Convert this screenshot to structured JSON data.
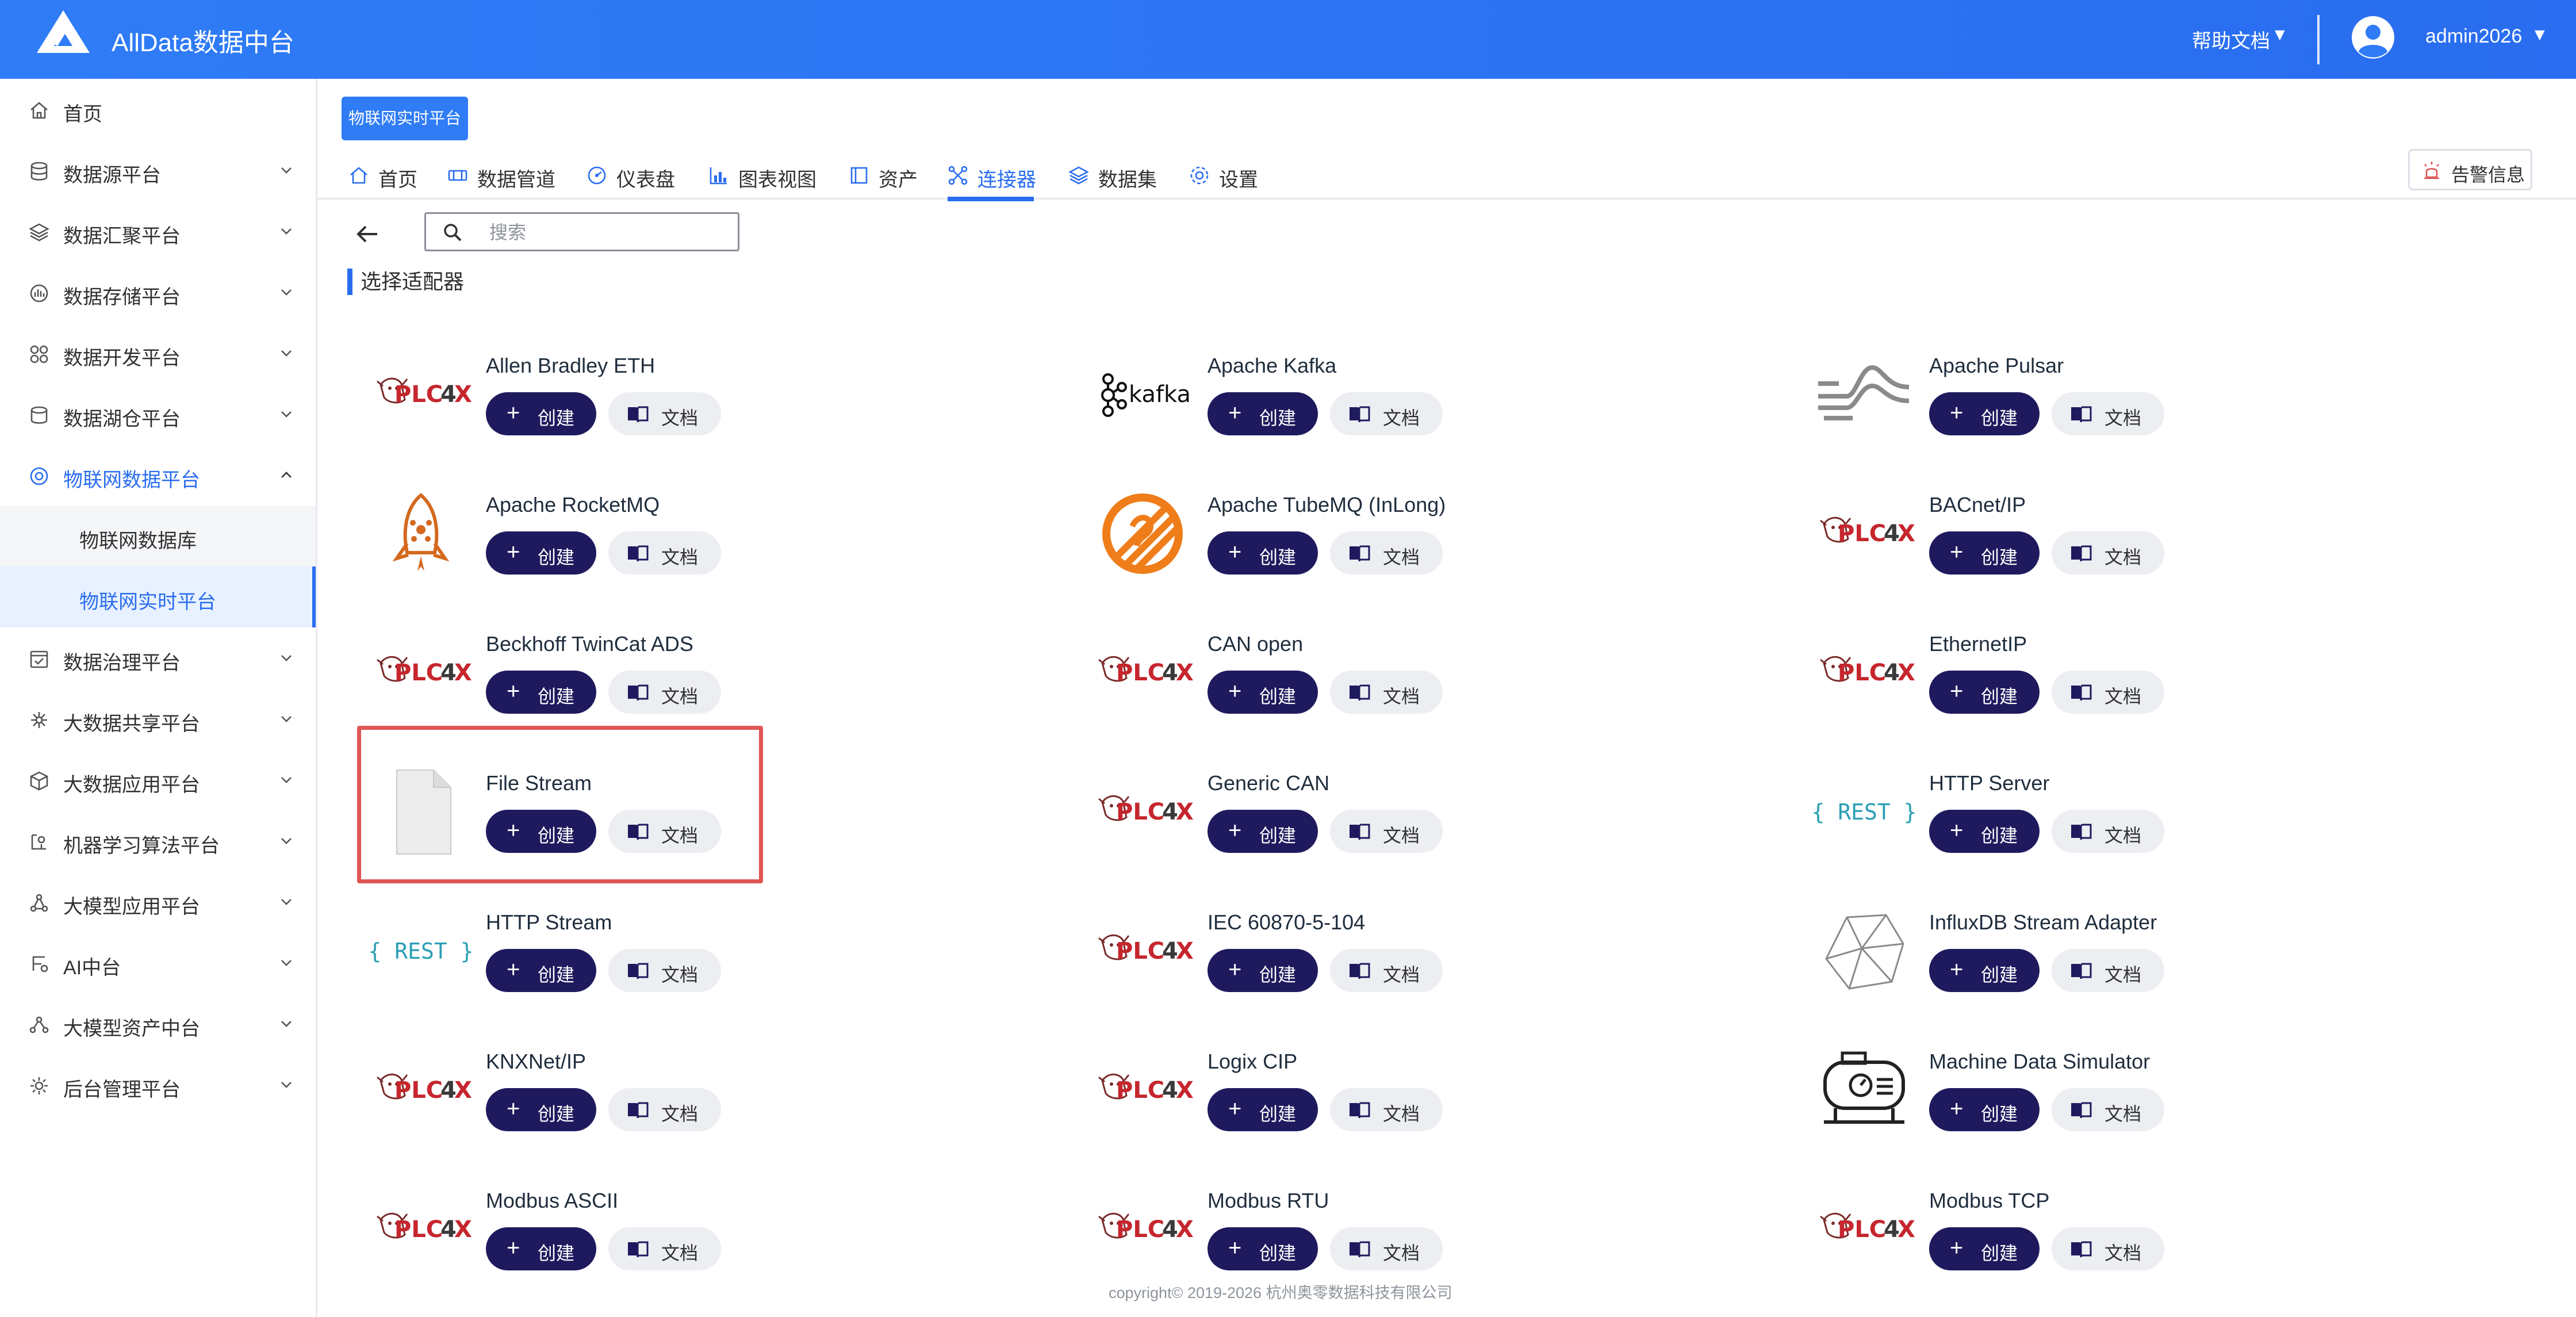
{
  "header": {
    "app_title": "AllData数据中台",
    "help_label": "帮助文档",
    "help_arrow": "▼",
    "username": "admin2026",
    "user_arrow": "▼"
  },
  "sidebar": {
    "items": [
      {
        "label": "首页",
        "icon": "home-icon"
      },
      {
        "label": "数据源平台",
        "icon": "database-icon"
      },
      {
        "label": "数据汇聚平台",
        "icon": "layers-icon"
      },
      {
        "label": "数据存储平台",
        "icon": "storage-icon"
      },
      {
        "label": "数据开发平台",
        "icon": "grid-icon"
      },
      {
        "label": "数据湖仓平台",
        "icon": "lakehouse-icon"
      },
      {
        "label": "物联网数据平台",
        "icon": "iot-icon"
      },
      {
        "label": "数据治理平台",
        "icon": "governance-icon"
      },
      {
        "label": "大数据共享平台",
        "icon": "share-icon"
      },
      {
        "label": "大数据应用平台",
        "icon": "cube-icon"
      },
      {
        "label": "机器学习算法平台",
        "icon": "ml-icon"
      },
      {
        "label": "大模型应用平台",
        "icon": "llm-icon"
      },
      {
        "label": "AI中台",
        "icon": "ai-icon"
      },
      {
        "label": "大模型资产中台",
        "icon": "asset-icon"
      },
      {
        "label": "后台管理平台",
        "icon": "admin-icon"
      }
    ],
    "sub_items": [
      {
        "label": "物联网数据库"
      },
      {
        "label": "物联网实时平台"
      }
    ]
  },
  "crumb_tag": "物联网实时平台",
  "tabs": [
    {
      "label": "首页",
      "icon": "home-icon"
    },
    {
      "label": "数据管道",
      "icon": "pipeline-icon"
    },
    {
      "label": "仪表盘",
      "icon": "dashboard-icon"
    },
    {
      "label": "图表视图",
      "icon": "chart-icon"
    },
    {
      "label": "资产",
      "icon": "asset-icon"
    },
    {
      "label": "连接器",
      "icon": "connector-icon"
    },
    {
      "label": "数据集",
      "icon": "dataset-icon"
    },
    {
      "label": "设置",
      "icon": "settings-icon"
    }
  ],
  "active_tab": "连接器",
  "alarm_label": "告警信息",
  "search": {
    "placeholder": "搜索",
    "value": ""
  },
  "section_title": "选择适配器",
  "buttons": {
    "create": "创建",
    "doc": "文档",
    "plus": "+"
  },
  "adapters": [
    {
      "name": "Allen Bradley ETH",
      "logo": "plc4x"
    },
    {
      "name": "Apache Kafka",
      "logo": "kafka"
    },
    {
      "name": "Apache Pulsar",
      "logo": "pulsar"
    },
    {
      "name": "Apache RocketMQ",
      "logo": "rocketmq"
    },
    {
      "name": "Apache TubeMQ (InLong)",
      "logo": "tubemq"
    },
    {
      "name": "BACnet/IP",
      "logo": "plc4x"
    },
    {
      "name": "Beckhoff TwinCat ADS",
      "logo": "plc4x"
    },
    {
      "name": "CAN open",
      "logo": "plc4x"
    },
    {
      "name": "EthernetIP",
      "logo": "plc4x"
    },
    {
      "name": "File Stream",
      "logo": "file"
    },
    {
      "name": "Generic CAN",
      "logo": "plc4x"
    },
    {
      "name": "HTTP Server",
      "logo": "rest"
    },
    {
      "name": "HTTP Stream",
      "logo": "rest"
    },
    {
      "name": "IEC 60870-5-104",
      "logo": "plc4x"
    },
    {
      "name": "InfluxDB Stream Adapter",
      "logo": "influxdb"
    },
    {
      "name": "KNXNet/IP",
      "logo": "plc4x"
    },
    {
      "name": "Logix CIP",
      "logo": "plc4x"
    },
    {
      "name": "Machine Data Simulator",
      "logo": "machine"
    },
    {
      "name": "Modbus ASCII",
      "logo": "plc4x"
    },
    {
      "name": "Modbus RTU",
      "logo": "plc4x"
    },
    {
      "name": "Modbus TCP",
      "logo": "plc4x"
    }
  ],
  "logo_text": {
    "plc4x": "PLC4X",
    "kafka": "kafka",
    "rest": "{ REST }"
  },
  "footer": "copyright© 2019-2026 杭州奥零数据科技有限公司",
  "colors": {
    "brand": "#2a6df0",
    "create_button": "#1f1a5e",
    "highlight": "#e05555"
  }
}
